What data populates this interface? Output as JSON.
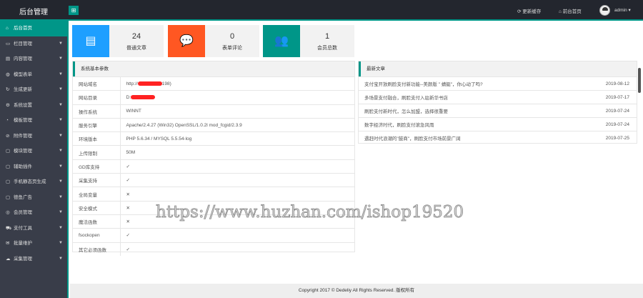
{
  "header": {
    "title": "后台管理",
    "menu_icon": "grid-icon",
    "nav": [
      {
        "label": "更新缓存",
        "icon": "refresh-icon"
      },
      {
        "label": "前台首页",
        "icon": "home-icon"
      }
    ],
    "user": "admin"
  },
  "sidebar": {
    "items": [
      {
        "label": "后台首页",
        "active": true,
        "icon": "home-icon"
      },
      {
        "label": "栏目管理",
        "icon": "monitor-icon"
      },
      {
        "label": "内容管理",
        "icon": "content-icon"
      },
      {
        "label": "模型表单",
        "icon": "globe-icon"
      },
      {
        "label": "生成更新",
        "icon": "refresh-icon"
      },
      {
        "label": "系统设置",
        "icon": "gear-icon"
      },
      {
        "label": "模板管理",
        "icon": "template-icon"
      },
      {
        "label": "附件管理",
        "icon": "attachment-icon"
      },
      {
        "label": "模块管理",
        "icon": "folder-icon"
      },
      {
        "label": "辅助插件",
        "icon": "folder-icon"
      },
      {
        "label": "手机静态页生成",
        "icon": "folder-icon"
      },
      {
        "label": "德鱼广告",
        "icon": "folder-icon"
      },
      {
        "label": "会员管理",
        "icon": "user-icon"
      },
      {
        "label": "支付工具",
        "icon": "cart-icon"
      },
      {
        "label": "批量维护",
        "icon": "mail-icon"
      },
      {
        "label": "采集管理",
        "icon": "cloud-icon"
      }
    ]
  },
  "stats": [
    {
      "value": "24",
      "label": "普通文章",
      "color": "#1e9fff",
      "icon": "document-icon"
    },
    {
      "value": "0",
      "label": "表单评论",
      "color": "#ff5722",
      "icon": "chat-icon"
    },
    {
      "value": "1",
      "label": "会员总数",
      "color": "#009688",
      "icon": "users-icon"
    }
  ],
  "system": {
    "title": "系统基本参数",
    "rows": [
      {
        "key": "网站域名",
        "value": "http://",
        "suffix": "198)",
        "redacted": true
      },
      {
        "key": "网站目录",
        "value": "D:",
        "redacted": true
      },
      {
        "key": "操作系统",
        "value": "WINNT"
      },
      {
        "key": "服务引擎",
        "value": "Apache/2.4.27 (Win32) OpenSSL/1.0.2l mod_fcgid/2.3.9"
      },
      {
        "key": "环境版本",
        "value": "PHP 5.6.34 / MYSQL 5.5.54-log"
      },
      {
        "key": "上传限制",
        "value": "50M"
      },
      {
        "key": "GD库支持",
        "value": "✓"
      },
      {
        "key": "采集支持",
        "value": "✓"
      },
      {
        "key": "全局变量",
        "value": "✕"
      },
      {
        "key": "安全模式",
        "value": "✕"
      },
      {
        "key": "魔法函数",
        "value": "✕"
      },
      {
        "key": "fsockopen",
        "value": "✓"
      },
      {
        "key": "其它必须函数",
        "value": "✓"
      }
    ]
  },
  "articles": {
    "title": "最新文章",
    "items": [
      {
        "title": "支付宝开放刷脸支付新功能--美颜版 \" 蜻蜓\"，你心动了吗?",
        "date": "2019-08-12"
      },
      {
        "title": "多场景支付融合，刷脸支付入驻新华书店",
        "date": "2019-07-17"
      },
      {
        "title": "刷脸支付新时代，怎么加盟，选择很重要",
        "date": "2019-07-24"
      },
      {
        "title": "数字经济时代，刷脸支付滚急风雨",
        "date": "2019-07-24"
      },
      {
        "title": "遇赶时代浪潮的\"鼓商\"，刷脸支付市场前景广阔",
        "date": "2019-07-25"
      }
    ]
  },
  "footer": "Copyright 2017 © Dedeliy All Rights Reserved. 版权所有",
  "watermark": "https://www.huzhan.com/ishop19520"
}
